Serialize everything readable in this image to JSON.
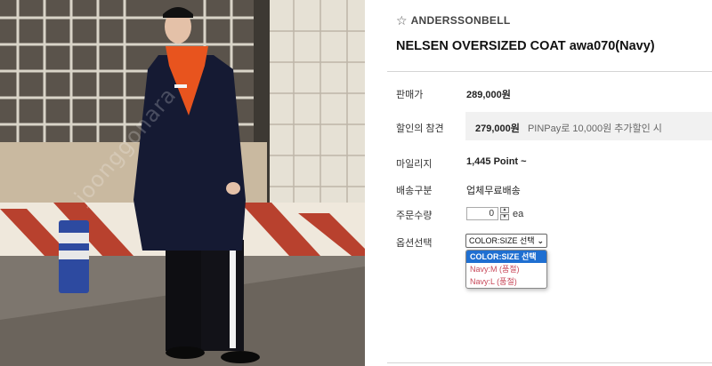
{
  "photo": {
    "alt": "Model wearing navy oversized coat",
    "watermark": "joonggonara"
  },
  "product": {
    "brand": "ANDERSSONBELL",
    "title": "NELSEN OVERSIZED COAT awa070(Navy)"
  },
  "details": {
    "price_label": "판매가",
    "price_value": "289,000원",
    "discount_label": "할인의 참견",
    "discount_price": "279,000원",
    "discount_note": "PINPay로 10,000원 추가할인 시",
    "mileage_label": "마일리지",
    "mileage_value": "1,445 Point ~",
    "shipping_label": "배송구분",
    "shipping_value": "업체무료배송",
    "qty_label": "주문수량",
    "qty_value": "0",
    "qty_unit": "ea",
    "option_label": "옵션선택",
    "option_selected": "COLOR:SIZE 선택"
  },
  "options": [
    {
      "label": "COLOR:SIZE 선택",
      "state": "selected"
    },
    {
      "label": "Navy:M (품절)",
      "state": "soldout"
    },
    {
      "label": "Navy:L (품절)",
      "state": "soldout"
    }
  ],
  "colors": {
    "selected_bg": "#1f6fd1",
    "soldout_text": "#c8485a",
    "coat": "#151a33",
    "hoodie": "#e8541e"
  },
  "icons": {
    "brand_star": "star-outline-icon",
    "select_chevron": "chevron-down-icon",
    "stepper_up": "triangle-up-icon",
    "stepper_down": "triangle-down-icon"
  }
}
